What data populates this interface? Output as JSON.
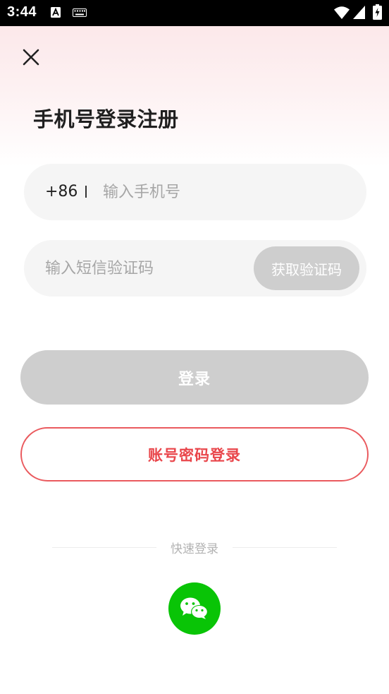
{
  "status_bar": {
    "time": "3:44"
  },
  "header": {
    "title": "手机号登录注册"
  },
  "phone": {
    "country_code": "+86",
    "placeholder": "输入手机号",
    "value": ""
  },
  "sms": {
    "placeholder": "输入短信验证码",
    "value": "",
    "get_code_label": "获取验证码"
  },
  "actions": {
    "login_label": "登录",
    "account_login_label": "账号密码登录"
  },
  "quick_login": {
    "label": "快速登录",
    "providers": [
      "wechat-icon"
    ]
  },
  "colors": {
    "accent_red": "#e9464b",
    "wechat_green": "#09c406",
    "disabled_gray": "#cecece",
    "input_bg": "#f5f5f5"
  }
}
